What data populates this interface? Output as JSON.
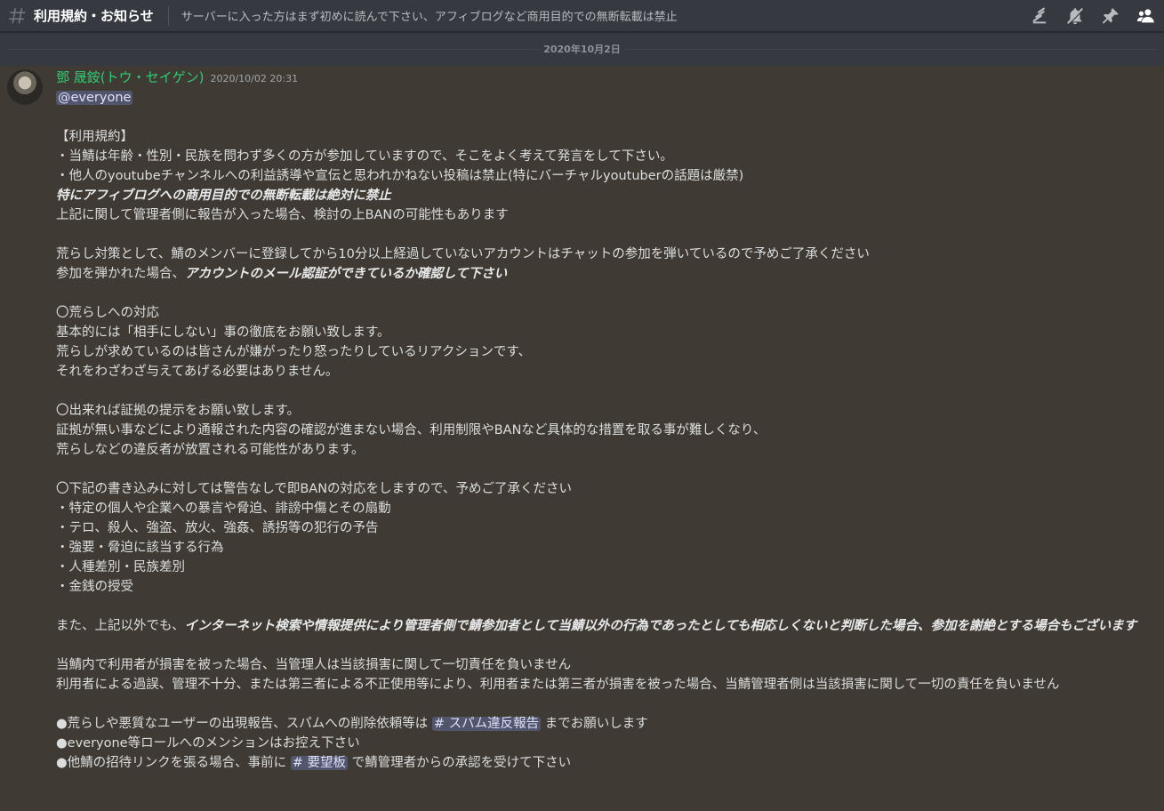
{
  "header": {
    "channel_icon": "hash-icon",
    "channel_name": "利用規約・お知らせ",
    "topic": "サーバーに入った方はまず初めに読んで下さい、アフィブログなど商用目的での無断転載は禁止",
    "toolbar_icons": [
      "threads-icon",
      "mute-bell-icon",
      "pin-icon",
      "members-icon"
    ]
  },
  "date_separator": "2020年10月2日",
  "message": {
    "author": "鄧 晟銨(トウ・セイゲン)",
    "author_color": "#2ecc71",
    "timestamp": "2020/10/02 20:31",
    "mention": "@everyone",
    "l01": "【利用規約】",
    "l02": "・当鯖は年齢・性別・民族を問わず多くの方が参加していますので、そこをよく考えて発言をして下さい。",
    "l03": "・他人のyoutubeチャンネルへの利益誘導や宣伝と思われかねない投稿は禁止(特にバーチャルyoutuberの話題は厳禁)",
    "l04": "特にアフィブログへの商用目的での無断転載は絶対に禁止",
    "l05": "上記に関して管理者側に報告が入った場合、検討の上BANの可能性もあります",
    "l06": "荒らし対策として、鯖のメンバーに登録してから10分以上経過していないアカウントはチャットの参加を弾いているので予めご了承ください",
    "l07a": "参加を弾かれた場合、",
    "l07b": "アカウントのメール認証ができているか確認して下さい",
    "l08": "〇荒らしへの対応",
    "l09": "基本的には「相手にしない」事の徹底をお願い致します。",
    "l10": "荒らしが求めているのは皆さんが嫌がったり怒ったりしているリアクションです、",
    "l11": "それをわざわざ与えてあげる必要はありません。",
    "l12": "〇出来れば証拠の提示をお願い致します。",
    "l13": "証拠が無い事などにより通報された内容の確認が進まない場合、利用制限やBANなど具体的な措置を取る事が難しくなり、",
    "l14": "荒らしなどの違反者が放置される可能性があります。",
    "l15": "〇下記の書き込みに対しては警告なしで即BANの対応をしますので、予めご了承ください",
    "l16": "・特定の個人や企業への暴言や脅迫、誹謗中傷とその扇動",
    "l17": "・テロ、殺人、強盗、放火、強姦、誘拐等の犯行の予告",
    "l18": "・強要・脅迫に該当する行為",
    "l19": "・人種差別・民族差別",
    "l20": "・金銭の授受",
    "l21a": "また、上記以外でも、",
    "l21b": "インターネット検索や情報提供により管理者側で鯖参加者として当鯖以外の行為であったとしても相応しくないと判断した場合、参加を謝絶とする場合もございます",
    "l22": "当鯖内で利用者が損害を被った場合、当管理人は当該損害に関して一切責任を負いません",
    "l23": "利用者による過誤、管理不十分、または第三者による不正使用等により、利用者または第三者が損害を被った場合、当鯖管理者側は当該損害に関して一切の責任を負いません",
    "l24a": "●荒らしや悪質なユーザーの出現報告、スパムへの削除依頼等は",
    "l24b": "# スパム違反報告",
    "l24c": "までお願いします",
    "l25": "●everyone等ロールへのメンションはお控え下さい",
    "l26a": "●他鯖の招待リンクを張る場合、事前に",
    "l26b": "# 要望板",
    "l26c": "で鯖管理者からの承認を受けて下さい"
  },
  "colors": {
    "background": "#36393f",
    "message_highlight": "#3f3b34",
    "mention_bg": "#4a5278"
  }
}
